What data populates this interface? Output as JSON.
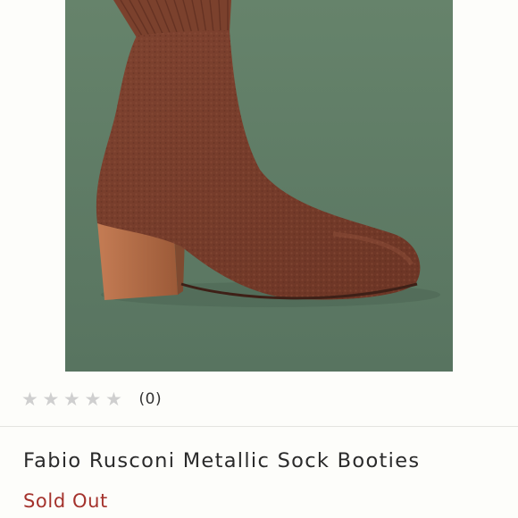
{
  "product": {
    "title": "Fabio Rusconi Metallic Sock Booties",
    "status": "Sold Out",
    "rating": {
      "value": 0,
      "max": 5,
      "count_label": "(0)"
    },
    "image": {
      "subject": "brown knit sock ankle boot with block heel",
      "background_color": "#5f7b64",
      "boot_color": "#7a3f2c",
      "heel_color": "#b87048"
    }
  },
  "colors": {
    "status_sold_out": "#a4322c",
    "star_empty": "#cfcfcf",
    "divider": "#e4e4e0"
  }
}
